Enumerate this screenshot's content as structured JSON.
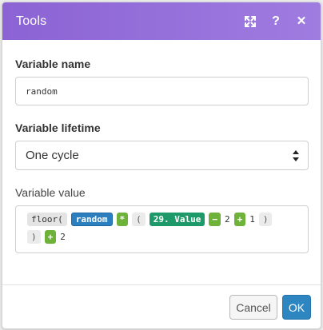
{
  "dialog": {
    "title": "Tools"
  },
  "fields": {
    "variable_name": {
      "label": "Variable name",
      "value": "random"
    },
    "variable_lifetime": {
      "label": "Variable lifetime",
      "value": "One cycle"
    },
    "variable_value": {
      "label": "Variable value",
      "line1": {
        "fn": "floor(",
        "var": "random",
        "op_mul": "*",
        "paren_open": "(",
        "module_ref": "29. Value",
        "op_minus": "−",
        "num_a": "2",
        "op_plus": "+",
        "num_b": "1",
        "paren_close": ")"
      },
      "line2": {
        "paren_close": ")",
        "op_plus": "+",
        "num_c": "2"
      }
    }
  },
  "buttons": {
    "cancel": "Cancel",
    "ok": "OK"
  },
  "colors": {
    "header": "#9573dc",
    "variable_token": "#2b7fbf",
    "module_token": "#1e9a6a",
    "operator_token": "#6fb23a",
    "ok_button": "#2e86c1"
  },
  "icons": [
    "expand-icon",
    "help-icon",
    "close-icon",
    "select-arrows-icon"
  ]
}
